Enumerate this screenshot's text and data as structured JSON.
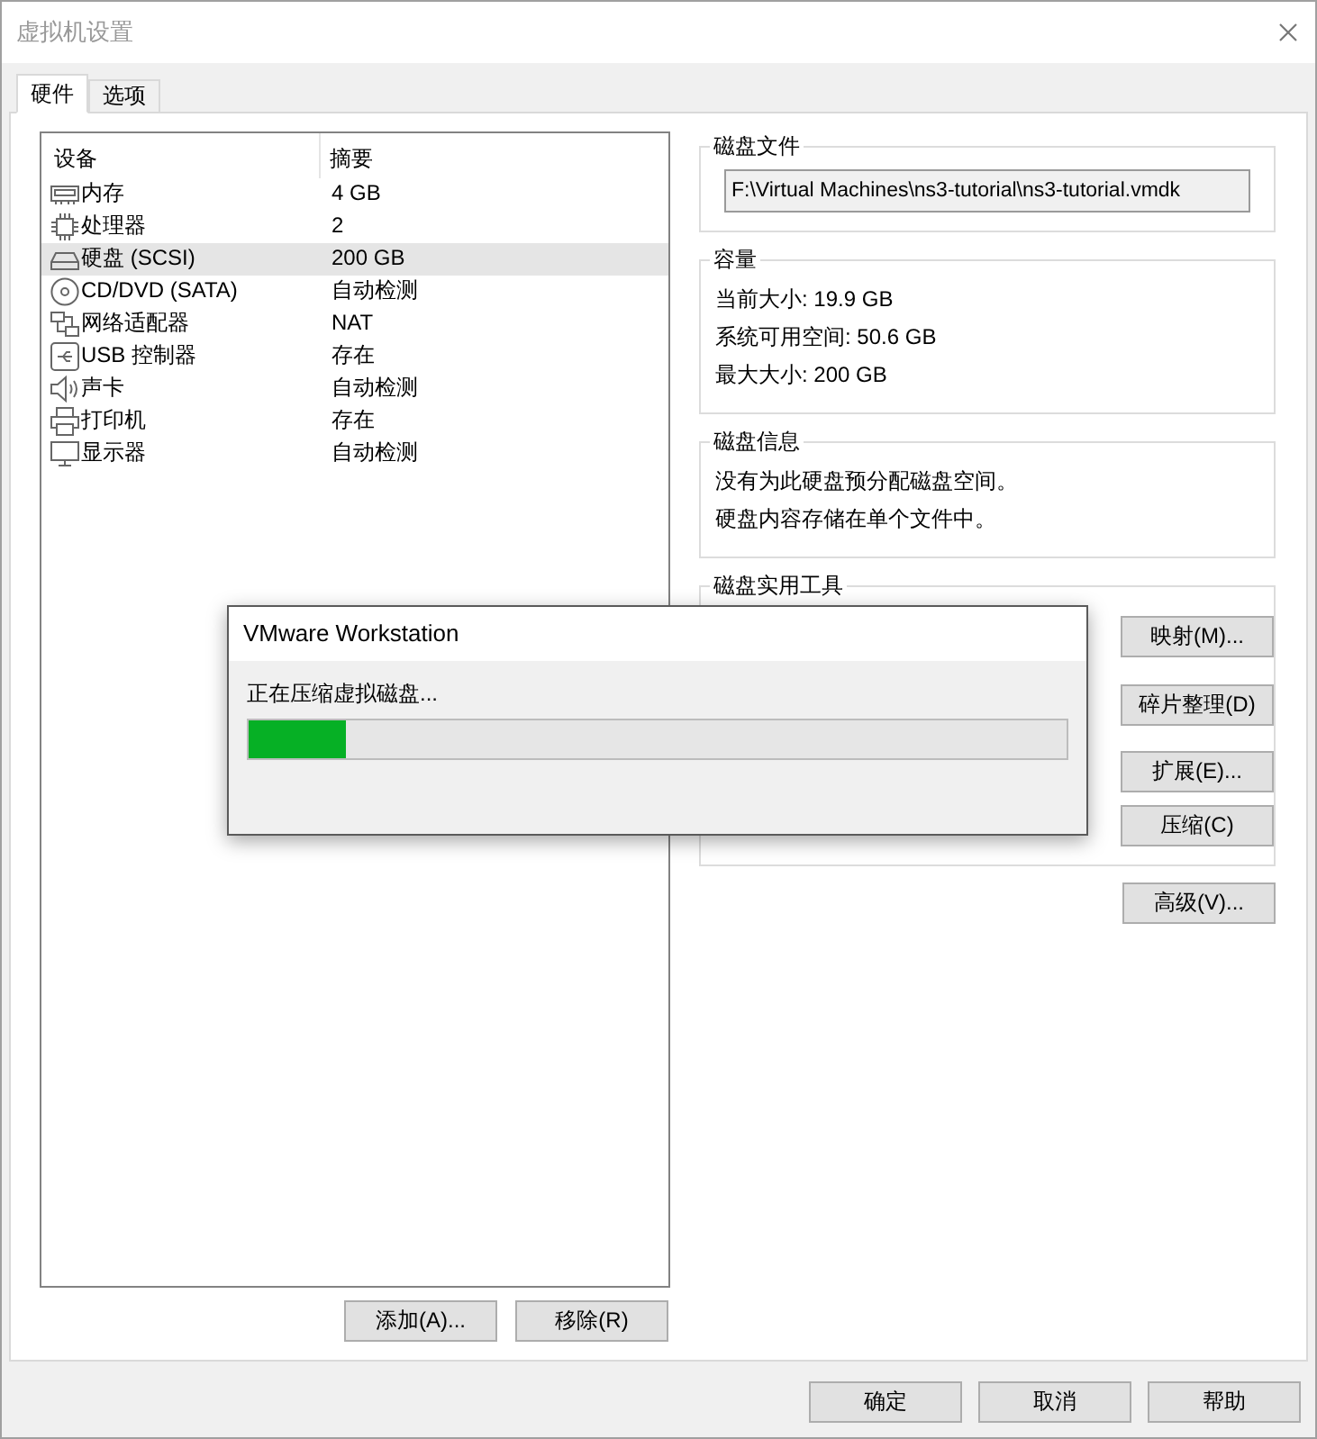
{
  "window": {
    "title": "虚拟机设置"
  },
  "tabs": [
    {
      "label": "硬件",
      "selected": true
    },
    {
      "label": "选项",
      "selected": false
    }
  ],
  "devices": {
    "columns": [
      "设备",
      "摘要"
    ],
    "rows": [
      {
        "kind": "memory",
        "name": "内存",
        "summary": "4 GB",
        "selected": false
      },
      {
        "kind": "processor",
        "name": "处理器",
        "summary": "2",
        "selected": false
      },
      {
        "kind": "disk",
        "name": "硬盘 (SCSI)",
        "summary": "200 GB",
        "selected": true
      },
      {
        "kind": "cdrom",
        "name": "CD/DVD (SATA)",
        "summary": "自动检测",
        "selected": false
      },
      {
        "kind": "network",
        "name": "网络适配器",
        "summary": "NAT",
        "selected": false
      },
      {
        "kind": "usb",
        "name": "USB 控制器",
        "summary": "存在",
        "selected": false
      },
      {
        "kind": "sound",
        "name": "声卡",
        "summary": "自动检测",
        "selected": false
      },
      {
        "kind": "printer",
        "name": "打印机",
        "summary": "存在",
        "selected": false
      },
      {
        "kind": "display",
        "name": "显示器",
        "summary": "自动检测",
        "selected": false
      }
    ]
  },
  "list_buttons": [
    "添加(A)...",
    "移除(R)"
  ],
  "disk_file": {
    "title": "磁盘文件",
    "value": "F:\\Virtual Machines\\ns3-tutorial\\ns3-tutorial.vmdk"
  },
  "capacity": {
    "title": "容量",
    "lines": [
      "当前大小: 19.9 GB",
      "系统可用空间: 50.6 GB",
      "最大大小: 200 GB"
    ]
  },
  "disk_info": {
    "title": "磁盘信息",
    "lines": [
      "没有为此硬盘预分配磁盘空间。",
      "硬盘内容存储在单个文件中。"
    ]
  },
  "disk_utilities": {
    "title": "磁盘实用工具",
    "buttons": [
      "映射(M)...",
      "碎片整理(D)",
      "扩展(E)...",
      "压缩(C)"
    ]
  },
  "advanced_button": "高级(V)...",
  "dialog_buttons": [
    "确定",
    "取消",
    "帮助"
  ],
  "progress_dialog": {
    "title": "VMware Workstation",
    "message": "正在压缩虚拟磁盘...",
    "level": 0.12
  }
}
